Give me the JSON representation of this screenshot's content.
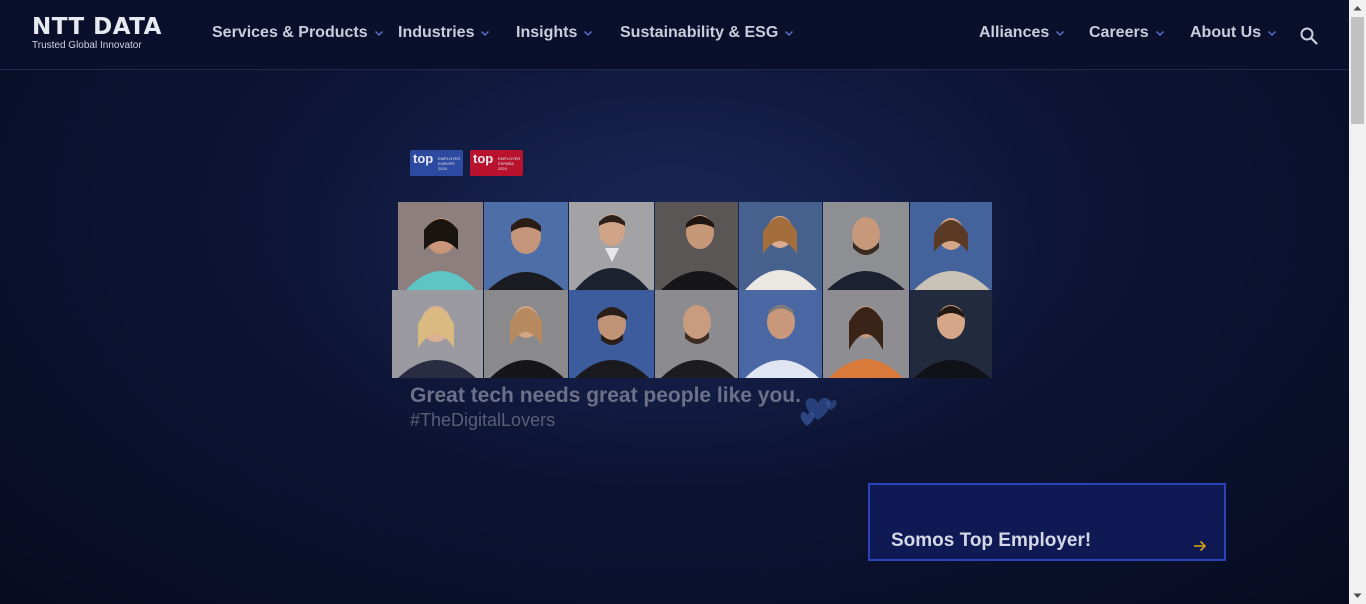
{
  "header": {
    "logo": {
      "name": "NTT DATA",
      "tagline": "Trusted Global Innovator"
    },
    "nav": [
      {
        "label": "Services & Products"
      },
      {
        "label": "Industries"
      },
      {
        "label": "Insights"
      },
      {
        "label": "Sustainability & ESG"
      },
      {
        "label": "Alliances"
      },
      {
        "label": "Careers"
      },
      {
        "label": "About Us"
      }
    ],
    "search_icon": "search-icon",
    "chevron_icon": "chevron-down-icon"
  },
  "hero": {
    "badges": [
      {
        "word": "top",
        "sub": "EMPLOYER EUROPE 2024",
        "color": "#2b4aa0"
      },
      {
        "word": "top",
        "sub": "EMPLOYER ESPAÑA 2024",
        "color": "#b8122e"
      }
    ],
    "title": "Great tech needs great people like you.",
    "hashtag": "#TheDigitalLovers",
    "cta": {
      "label": "Somos Top Employer!",
      "icon": "arrow-right-icon",
      "accent": "#d4a017"
    }
  },
  "colors": {
    "background": "#0a0f2a",
    "cta_border": "#2a43b8",
    "cta_fill": "#0f1a55"
  }
}
